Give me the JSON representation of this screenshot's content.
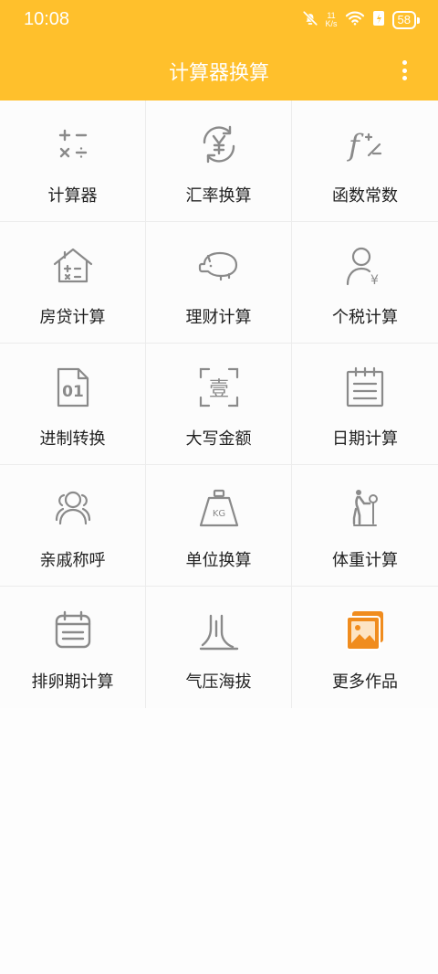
{
  "status_bar": {
    "time": "10:08",
    "net_speed_value": "11",
    "net_speed_unit": "K/s",
    "battery": "58",
    "icons": [
      "bell-off-icon",
      "wifi-icon",
      "battery-saver-icon",
      "battery-icon"
    ]
  },
  "app_bar": {
    "title": "计算器换算",
    "menu_icon": "more-vertical-icon"
  },
  "colors": {
    "accent": "#ffc02c",
    "icon_gray": "#8a8a8a",
    "orange_icon": "#f08c1e",
    "text": "#222222",
    "divider": "#ececec"
  },
  "grid": {
    "items": [
      {
        "label": "计算器",
        "icon": "calculator-icon"
      },
      {
        "label": "汇率换算",
        "icon": "currency-exchange-icon"
      },
      {
        "label": "函数常数",
        "icon": "function-icon"
      },
      {
        "label": "房贷计算",
        "icon": "house-calculator-icon"
      },
      {
        "label": "理财计算",
        "icon": "piggy-bank-icon"
      },
      {
        "label": "个税计算",
        "icon": "person-yen-icon"
      },
      {
        "label": "进制转换",
        "icon": "binary-file-icon"
      },
      {
        "label": "大写金额",
        "icon": "scan-character-icon"
      },
      {
        "label": "日期计算",
        "icon": "calendar-notes-icon"
      },
      {
        "label": "亲戚称呼",
        "icon": "relatives-group-icon"
      },
      {
        "label": "单位换算",
        "icon": "kg-weight-icon"
      },
      {
        "label": "体重计算",
        "icon": "scale-person-icon"
      },
      {
        "label": "排卵期计算",
        "icon": "calendar-list-icon"
      },
      {
        "label": "气压海拔",
        "icon": "pressure-altitude-icon"
      },
      {
        "label": "更多作品",
        "icon": "gallery-image-icon"
      }
    ],
    "icon_text": {
      "function_symbol": "f",
      "binary_digits": "01",
      "scan_character": "壹",
      "weight_unit": "KG",
      "yen_symbol": "¥"
    }
  }
}
